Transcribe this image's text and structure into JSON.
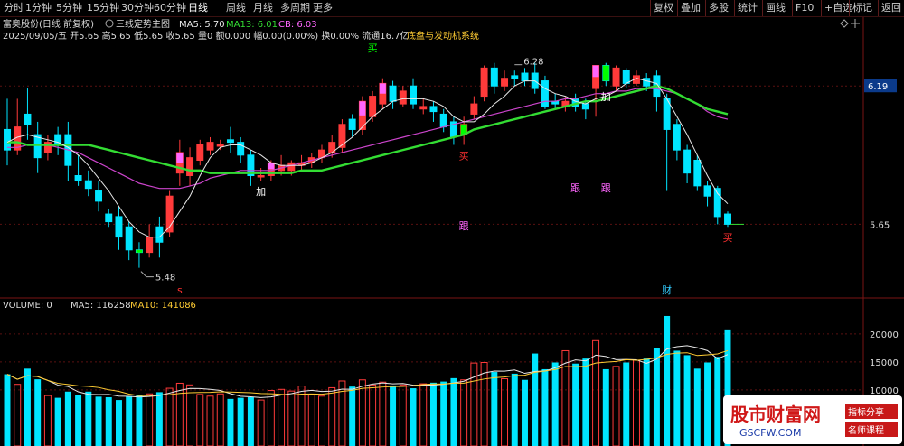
{
  "toolbar": {
    "periods": [
      "分时",
      "1分钟",
      "5分钟",
      "15分钟",
      "30分钟",
      "60分钟",
      "日线",
      "周线",
      "月线",
      "多周期",
      "更多"
    ],
    "active_period": "日线",
    "right_buttons": [
      "复权",
      "叠加",
      "多股",
      "统计",
      "画线",
      "F10",
      "+自选",
      "标记",
      "返回"
    ]
  },
  "header": {
    "title": "富奥股份(日线 前复权)",
    "indicator_name": "三线定势主图",
    "ma5_label": "MA5: 5.70",
    "ma13_label": "MA13: 6.01",
    "cb_label": "CB: 6.03",
    "info_line": "2025/09/05/五 开5.65 高5.65 低5.65 收5.65 量0 额0.000 幅0.00(0.00%) 换0.00% 流通16.7亿",
    "system_label": "底盘与发动机系统"
  },
  "price_axis": {
    "current_price": "6.19",
    "last_price": "5.65",
    "high_marker": "6.28",
    "low_marker": "5.48"
  },
  "volume_header": {
    "title": "VOLUME: 0",
    "ma5": "MA5: 116258",
    "ma10": "MA10: 141086",
    "ticks": [
      "20000",
      "15000",
      "10000"
    ]
  },
  "signals": [
    {
      "text": "买",
      "i": 36,
      "pos": "top",
      "color": "#00ff00"
    },
    {
      "text": "加",
      "i": 25,
      "pos": "below",
      "color": "#ffffff"
    },
    {
      "text": "买",
      "i": 45,
      "pos": "below",
      "color": "#ff3030"
    },
    {
      "text": "跟",
      "i": 56,
      "pos": "mid1",
      "color": "#ff66ff"
    },
    {
      "text": "跟",
      "i": 45,
      "pos": "mid2",
      "color": "#ff66ff"
    },
    {
      "text": "跟",
      "i": 59,
      "pos": "mid1",
      "color": "#ff66ff"
    },
    {
      "text": "加",
      "i": 59,
      "pos": "below",
      "color": "#ffffff"
    },
    {
      "text": "买",
      "i": 71,
      "pos": "below",
      "color": "#ff3030"
    },
    {
      "text": "财",
      "i": 65,
      "pos": "bottom",
      "color": "#33ccff"
    },
    {
      "text": "s",
      "i": 17,
      "pos": "bottom",
      "color": "#ff3030"
    }
  ],
  "watermark": {
    "main": "股市财富网",
    "sub": "GSCFW.COM",
    "tag1": "指标分享",
    "tag2": "名师课程"
  },
  "colors": {
    "up": "#ff3a3a",
    "down": "#00e5ff",
    "ma5": "#e8e8e8",
    "ma13": "#cc44cc",
    "cb": "#33dd33",
    "buy_box": "#00ff00",
    "pink_box": "#ff66ff"
  },
  "chart_data": {
    "type": "candlestick",
    "x_label_hidden": true,
    "ylim_price": [
      5.38,
      6.36
    ],
    "ylim_volume": [
      0,
      24000
    ],
    "candles": [
      {
        "o": 6.02,
        "c": 5.94,
        "h": 6.14,
        "l": 5.88,
        "v": 12800
      },
      {
        "o": 5.94,
        "c": 6.03,
        "h": 6.14,
        "l": 5.92,
        "v": 11000
      },
      {
        "o": 6.08,
        "c": 6.04,
        "h": 6.18,
        "l": 5.98,
        "v": 13800
      },
      {
        "o": 6.0,
        "c": 5.91,
        "h": 6.05,
        "l": 5.85,
        "v": 11900
      },
      {
        "o": 5.93,
        "c": 5.97,
        "h": 6.0,
        "l": 5.9,
        "v": 9000
      },
      {
        "o": 6.0,
        "c": 5.96,
        "h": 6.03,
        "l": 5.92,
        "v": 8600
      },
      {
        "o": 6.0,
        "c": 5.88,
        "h": 6.05,
        "l": 5.82,
        "v": 9700
      },
      {
        "o": 5.84,
        "c": 5.82,
        "h": 5.92,
        "l": 5.8,
        "v": 9100
      },
      {
        "o": 5.82,
        "c": 5.79,
        "h": 5.86,
        "l": 5.76,
        "v": 9700
      },
      {
        "o": 5.78,
        "c": 5.74,
        "h": 5.82,
        "l": 5.7,
        "v": 8800
      },
      {
        "o": 5.69,
        "c": 5.66,
        "h": 5.71,
        "l": 5.64,
        "v": 8700
      },
      {
        "o": 5.68,
        "c": 5.6,
        "h": 5.72,
        "l": 5.55,
        "v": 8200
      },
      {
        "o": 5.64,
        "c": 5.55,
        "h": 5.66,
        "l": 5.51,
        "v": 8900
      },
      {
        "o": 5.55,
        "c": 5.54,
        "h": 5.58,
        "l": 5.48,
        "v": 9100
      },
      {
        "o": 5.54,
        "c": 5.6,
        "h": 5.65,
        "l": 5.52,
        "v": 9300
      },
      {
        "o": 5.64,
        "c": 5.58,
        "h": 5.68,
        "l": 5.52,
        "v": 9600
      },
      {
        "o": 5.62,
        "c": 5.76,
        "h": 5.78,
        "l": 5.6,
        "v": 10300
      },
      {
        "o": 5.85,
        "c": 5.93,
        "h": 5.98,
        "l": 5.8,
        "v": 11200
      },
      {
        "o": 5.84,
        "c": 5.91,
        "h": 5.95,
        "l": 5.8,
        "v": 10900
      },
      {
        "o": 5.9,
        "c": 5.96,
        "h": 5.98,
        "l": 5.88,
        "v": 9200
      },
      {
        "o": 5.94,
        "c": 5.97,
        "h": 5.99,
        "l": 5.92,
        "v": 8900
      },
      {
        "o": 5.96,
        "c": 5.96,
        "h": 5.98,
        "l": 5.94,
        "v": 9300
      },
      {
        "o": 5.98,
        "c": 5.97,
        "h": 6.03,
        "l": 5.93,
        "v": 8400
      },
      {
        "o": 5.97,
        "c": 5.92,
        "h": 5.99,
        "l": 5.89,
        "v": 8600
      },
      {
        "o": 5.92,
        "c": 5.84,
        "h": 5.94,
        "l": 5.8,
        "v": 8700
      },
      {
        "o": 5.84,
        "c": 5.84,
        "h": 5.87,
        "l": 5.82,
        "v": 8200
      },
      {
        "o": 5.84,
        "c": 5.89,
        "h": 5.9,
        "l": 5.82,
        "v": 9900
      },
      {
        "o": 5.86,
        "c": 5.88,
        "h": 5.92,
        "l": 5.84,
        "v": 10100
      },
      {
        "o": 5.86,
        "c": 5.89,
        "h": 5.9,
        "l": 5.84,
        "v": 9800
      },
      {
        "o": 5.88,
        "c": 5.89,
        "h": 5.92,
        "l": 5.86,
        "v": 10700
      },
      {
        "o": 5.89,
        "c": 5.91,
        "h": 5.93,
        "l": 5.87,
        "v": 9100
      },
      {
        "o": 5.91,
        "c": 5.94,
        "h": 5.96,
        "l": 5.89,
        "v": 8900
      },
      {
        "o": 5.93,
        "c": 5.97,
        "h": 6.0,
        "l": 5.91,
        "v": 10400
      },
      {
        "o": 5.95,
        "c": 6.04,
        "h": 6.06,
        "l": 5.93,
        "v": 11600
      },
      {
        "o": 6.06,
        "c": 6.02,
        "h": 6.08,
        "l": 5.99,
        "v": 10600
      },
      {
        "o": 6.02,
        "c": 6.13,
        "h": 6.15,
        "l": 6.0,
        "v": 11800
      },
      {
        "o": 6.07,
        "c": 6.15,
        "h": 6.17,
        "l": 6.05,
        "v": 10900
      },
      {
        "o": 6.12,
        "c": 6.2,
        "h": 6.22,
        "l": 6.1,
        "v": 11400
      },
      {
        "o": 6.19,
        "c": 6.13,
        "h": 6.21,
        "l": 6.1,
        "v": 10800
      },
      {
        "o": 6.12,
        "c": 6.17,
        "h": 6.19,
        "l": 6.11,
        "v": 10900
      },
      {
        "o": 6.19,
        "c": 6.12,
        "h": 6.22,
        "l": 6.1,
        "v": 10300
      },
      {
        "o": 6.1,
        "c": 6.11,
        "h": 6.14,
        "l": 6.08,
        "v": 11100
      },
      {
        "o": 6.11,
        "c": 6.09,
        "h": 6.13,
        "l": 6.05,
        "v": 11300
      },
      {
        "o": 6.08,
        "c": 6.03,
        "h": 6.1,
        "l": 6.01,
        "v": 11500
      },
      {
        "o": 6.05,
        "c": 5.99,
        "h": 6.07,
        "l": 5.96,
        "v": 12100
      },
      {
        "o": 6.0,
        "c": 6.04,
        "h": 6.07,
        "l": 5.96,
        "v": 11800
      },
      {
        "o": 6.08,
        "c": 6.12,
        "h": 6.15,
        "l": 6.06,
        "v": 14800
      },
      {
        "o": 6.15,
        "c": 6.26,
        "h": 6.27,
        "l": 6.13,
        "v": 14900
      },
      {
        "o": 6.26,
        "c": 6.19,
        "h": 6.28,
        "l": 6.16,
        "v": 13200
      },
      {
        "o": 6.19,
        "c": 6.22,
        "h": 6.25,
        "l": 6.17,
        "v": 12000
      },
      {
        "o": 6.23,
        "c": 6.22,
        "h": 6.25,
        "l": 6.19,
        "v": 12900
      },
      {
        "o": 6.24,
        "c": 6.21,
        "h": 6.26,
        "l": 6.19,
        "v": 11800
      },
      {
        "o": 6.24,
        "c": 6.18,
        "h": 6.28,
        "l": 6.16,
        "v": 16500
      },
      {
        "o": 6.21,
        "c": 6.11,
        "h": 6.23,
        "l": 6.1,
        "v": 13700
      },
      {
        "o": 6.13,
        "c": 6.12,
        "h": 6.16,
        "l": 6.1,
        "v": 14900
      },
      {
        "o": 6.11,
        "c": 6.13,
        "h": 6.15,
        "l": 6.09,
        "v": 17000
      },
      {
        "o": 6.14,
        "c": 6.11,
        "h": 6.16,
        "l": 6.09,
        "v": 14700
      },
      {
        "o": 6.12,
        "c": 6.1,
        "h": 6.14,
        "l": 6.06,
        "v": 15600
      },
      {
        "o": 6.18,
        "c": 6.27,
        "h": 6.27,
        "l": 6.07,
        "v": 18800
      },
      {
        "o": 6.27,
        "c": 6.21,
        "h": 6.28,
        "l": 6.19,
        "v": 13700
      },
      {
        "o": 6.19,
        "c": 6.26,
        "h": 6.27,
        "l": 6.17,
        "v": 14200
      },
      {
        "o": 6.25,
        "c": 6.2,
        "h": 6.26,
        "l": 6.18,
        "v": 14900
      },
      {
        "o": 6.2,
        "c": 6.23,
        "h": 6.25,
        "l": 6.19,
        "v": 15300
      },
      {
        "o": 6.22,
        "c": 6.19,
        "h": 6.24,
        "l": 6.17,
        "v": 15600
      },
      {
        "o": 6.23,
        "c": 6.15,
        "h": 6.25,
        "l": 6.09,
        "v": 17500
      },
      {
        "o": 6.14,
        "c": 6.02,
        "h": 6.16,
        "l": 5.78,
        "v": 23200
      },
      {
        "o": 6.04,
        "c": 5.94,
        "h": 6.06,
        "l": 5.9,
        "v": 17000
      },
      {
        "o": 5.94,
        "c": 5.85,
        "h": 5.96,
        "l": 5.81,
        "v": 16200
      },
      {
        "o": 5.9,
        "c": 5.8,
        "h": 5.92,
        "l": 5.78,
        "v": 13800
      },
      {
        "o": 5.8,
        "c": 5.76,
        "h": 5.82,
        "l": 5.72,
        "v": 14900
      },
      {
        "o": 5.79,
        "c": 5.68,
        "h": 5.8,
        "l": 5.65,
        "v": 15900
      },
      {
        "o": 5.69,
        "c": 5.65,
        "h": 5.7,
        "l": 5.64,
        "v": 20800
      }
    ],
    "ma5": [
      5.97,
      5.99,
      6.0,
      5.99,
      5.98,
      5.97,
      5.95,
      5.92,
      5.88,
      5.83,
      5.78,
      5.72,
      5.66,
      5.62,
      5.6,
      5.6,
      5.64,
      5.7,
      5.76,
      5.84,
      5.91,
      5.95,
      5.96,
      5.96,
      5.94,
      5.92,
      5.89,
      5.88,
      5.88,
      5.88,
      5.89,
      5.91,
      5.93,
      5.96,
      5.99,
      6.03,
      6.07,
      6.1,
      6.13,
      6.14,
      6.14,
      6.14,
      6.13,
      6.11,
      6.07,
      6.05,
      6.05,
      6.08,
      6.12,
      6.15,
      6.19,
      6.21,
      6.21,
      6.18,
      6.16,
      6.15,
      6.13,
      6.12,
      6.14,
      6.15,
      6.17,
      6.2,
      6.22,
      6.21,
      6.2,
      6.14,
      6.07,
      6.0,
      5.92,
      5.84,
      5.77,
      5.73
    ],
    "ma13": [
      5.95,
      5.95,
      5.96,
      5.96,
      5.96,
      5.95,
      5.94,
      5.93,
      5.91,
      5.89,
      5.87,
      5.85,
      5.83,
      5.81,
      5.8,
      5.79,
      5.79,
      5.79,
      5.8,
      5.81,
      5.83,
      5.84,
      5.85,
      5.86,
      5.86,
      5.86,
      5.86,
      5.87,
      5.88,
      5.89,
      5.9,
      5.91,
      5.92,
      5.93,
      5.94,
      5.95,
      5.96,
      5.97,
      5.98,
      5.99,
      6.0,
      6.01,
      6.02,
      6.03,
      6.04,
      6.05,
      6.06,
      6.07,
      6.08,
      6.09,
      6.1,
      6.11,
      6.12,
      6.13,
      6.13,
      6.14,
      6.14,
      6.15,
      6.16,
      6.16,
      6.17,
      6.17,
      6.18,
      6.18,
      6.18,
      6.17,
      6.16,
      6.14,
      6.12,
      6.09,
      6.07,
      6.06
    ],
    "cb": [
      5.97,
      5.97,
      5.96,
      5.96,
      5.96,
      5.96,
      5.96,
      5.96,
      5.96,
      5.95,
      5.94,
      5.93,
      5.92,
      5.91,
      5.9,
      5.89,
      5.88,
      5.87,
      5.86,
      5.86,
      5.85,
      5.85,
      5.85,
      5.85,
      5.85,
      5.85,
      5.85,
      5.85,
      5.85,
      5.86,
      5.86,
      5.86,
      5.87,
      5.88,
      5.89,
      5.9,
      5.91,
      5.92,
      5.93,
      5.94,
      5.95,
      5.96,
      5.97,
      5.98,
      5.99,
      6.0,
      6.02,
      6.03,
      6.04,
      6.05,
      6.06,
      6.07,
      6.08,
      6.09,
      6.1,
      6.11,
      6.12,
      6.13,
      6.13,
      6.14,
      6.15,
      6.16,
      6.17,
      6.18,
      6.19,
      6.18,
      6.16,
      6.14,
      6.12,
      6.1,
      6.09,
      6.08
    ]
  }
}
